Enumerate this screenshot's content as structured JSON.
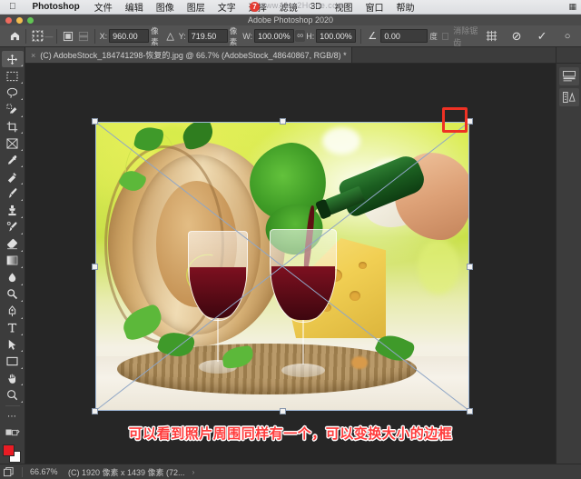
{
  "menubar": {
    "apple_icon": "apple-logo",
    "app_name": "Photoshop",
    "items": [
      "文件",
      "编辑",
      "图像",
      "图层",
      "文字",
      "选择",
      "滤镜",
      "3D",
      "视图",
      "窗口",
      "帮助"
    ],
    "system_icon": "grid-icon",
    "watermark_text": "www.Mac2Home.com",
    "watermark_badge": "7"
  },
  "window": {
    "title": "Adobe Photoshop 2020",
    "traffic_lights": [
      "close",
      "minimize",
      "zoom"
    ]
  },
  "options_bar": {
    "home_icon": "home-icon",
    "reference_point_icon": "reference-point-grid",
    "align_icon": "align-icon",
    "x_label": "X:",
    "x_value": "960.00",
    "x_unit": "像素",
    "delta_icon": "delta-triangle-icon",
    "y_label": "Y:",
    "y_value": "719.50",
    "y_unit": "像素",
    "w_label": "W:",
    "w_value": "100.00%",
    "link_icon": "link-chain-icon",
    "h_label": "H:",
    "h_value": "100.00%",
    "angle_icon": "angle-icon",
    "angle_value": "0.00",
    "angle_unit": "度",
    "antialias_checkbox": "消除锯齿",
    "warp_icon": "warp-icon",
    "cancel_icon": "cancel-transform-icon",
    "commit_icon": "commit-transform-icon",
    "extra_icon": "circle-icon"
  },
  "document_tab": {
    "close_icon": "×",
    "title": "(C) AdobeStock_184741298-恢复的.jpg @ 66.7% (AdobeStock_48640867, RGB/8) *"
  },
  "toolbar": {
    "tools": [
      {
        "name": "move-tool",
        "glyph": "move",
        "active": true
      },
      {
        "name": "marquee-tool",
        "glyph": "marquee",
        "active": false
      },
      {
        "name": "lasso-tool",
        "glyph": "lasso",
        "active": false
      },
      {
        "name": "quick-selection-tool",
        "glyph": "quickselect",
        "active": false
      },
      {
        "name": "crop-tool",
        "glyph": "crop",
        "active": false
      },
      {
        "name": "frame-tool",
        "glyph": "frame",
        "active": false
      },
      {
        "name": "eyedropper-tool",
        "glyph": "eyedropper",
        "active": false
      },
      {
        "name": "healing-brush-tool",
        "glyph": "healing",
        "active": false
      },
      {
        "name": "brush-tool",
        "glyph": "brush",
        "active": false
      },
      {
        "name": "clone-stamp-tool",
        "glyph": "stamp",
        "active": false
      },
      {
        "name": "history-brush-tool",
        "glyph": "historybrush",
        "active": false
      },
      {
        "name": "eraser-tool",
        "glyph": "eraser",
        "active": false
      },
      {
        "name": "gradient-tool",
        "glyph": "gradient",
        "active": false
      },
      {
        "name": "blur-tool",
        "glyph": "blur",
        "active": false
      },
      {
        "name": "dodge-tool",
        "glyph": "dodge",
        "active": false
      },
      {
        "name": "pen-tool",
        "glyph": "pen",
        "active": false
      },
      {
        "name": "type-tool",
        "glyph": "type",
        "active": false
      },
      {
        "name": "path-selection-tool",
        "glyph": "pathselect",
        "active": false
      },
      {
        "name": "rectangle-tool",
        "glyph": "rectangle",
        "active": false
      },
      {
        "name": "hand-tool",
        "glyph": "hand",
        "active": false
      },
      {
        "name": "zoom-tool",
        "glyph": "zoom",
        "active": false
      },
      {
        "name": "edit-toolbar-button",
        "glyph": "ellipsis",
        "active": false
      }
    ],
    "foreground_color": "#ea1c24",
    "background_color": "#ffffff",
    "quickmask_icon": "quick-mask-icon",
    "screenmode_icon": "screen-mode-icon"
  },
  "canvas": {
    "zoom_percent": "66.7%",
    "transform_handles": 8,
    "highlight_label": "corner-handle-highlight",
    "highlight_color": "#ee3124"
  },
  "annotation": {
    "text": "可以看到照片周围同样有一个，可以变换大小的边框",
    "color": "#ff3b3b"
  },
  "right_dock": {
    "buttons": [
      "color-panel-icon",
      "adjustments-panel-icon"
    ]
  },
  "status_bar": {
    "doc_icon": "document-icon",
    "zoom": "66.67%",
    "doc_info": "(C) 1920 像素 x 1439 像素 (72...",
    "arrow_icon": "›"
  }
}
